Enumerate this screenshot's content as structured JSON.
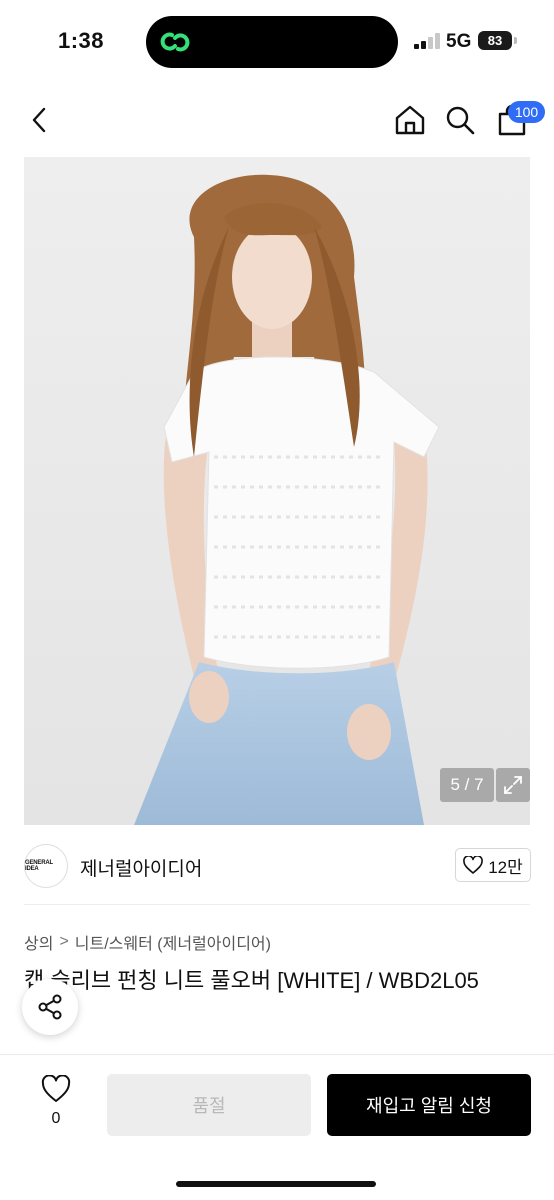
{
  "status_bar": {
    "time": "1:38",
    "network": "5G",
    "battery": "83",
    "island_icon_color": "#35e07a"
  },
  "header": {
    "back_icon": "chevron-left-icon",
    "home_icon": "home-icon",
    "search_icon": "search-icon",
    "cart_icon": "shopping-bag-icon",
    "cart_badge": "100",
    "badge_color": "#2f6df6"
  },
  "gallery": {
    "counter": "5 / 7",
    "expand_icon": "expand-icon"
  },
  "store": {
    "logo_text": "GENERAL IDEA",
    "name": "제너럴아이디어",
    "like_icon": "heart-outline-icon",
    "like_count": "12만"
  },
  "breadcrumb": {
    "category": "상의",
    "separator": ">",
    "subcategory": "니트/스웨터 (제너럴아이디어)"
  },
  "product": {
    "title": "캡 슬리브 펀칭 니트 풀오버 [WHITE] / WBD2L05",
    "title_continued": "5"
  },
  "bottom_bar": {
    "wish_icon": "heart-outline-icon",
    "wish_count": "0",
    "sold_out_label": "품절",
    "restock_label": "재입고 알림 신청"
  }
}
